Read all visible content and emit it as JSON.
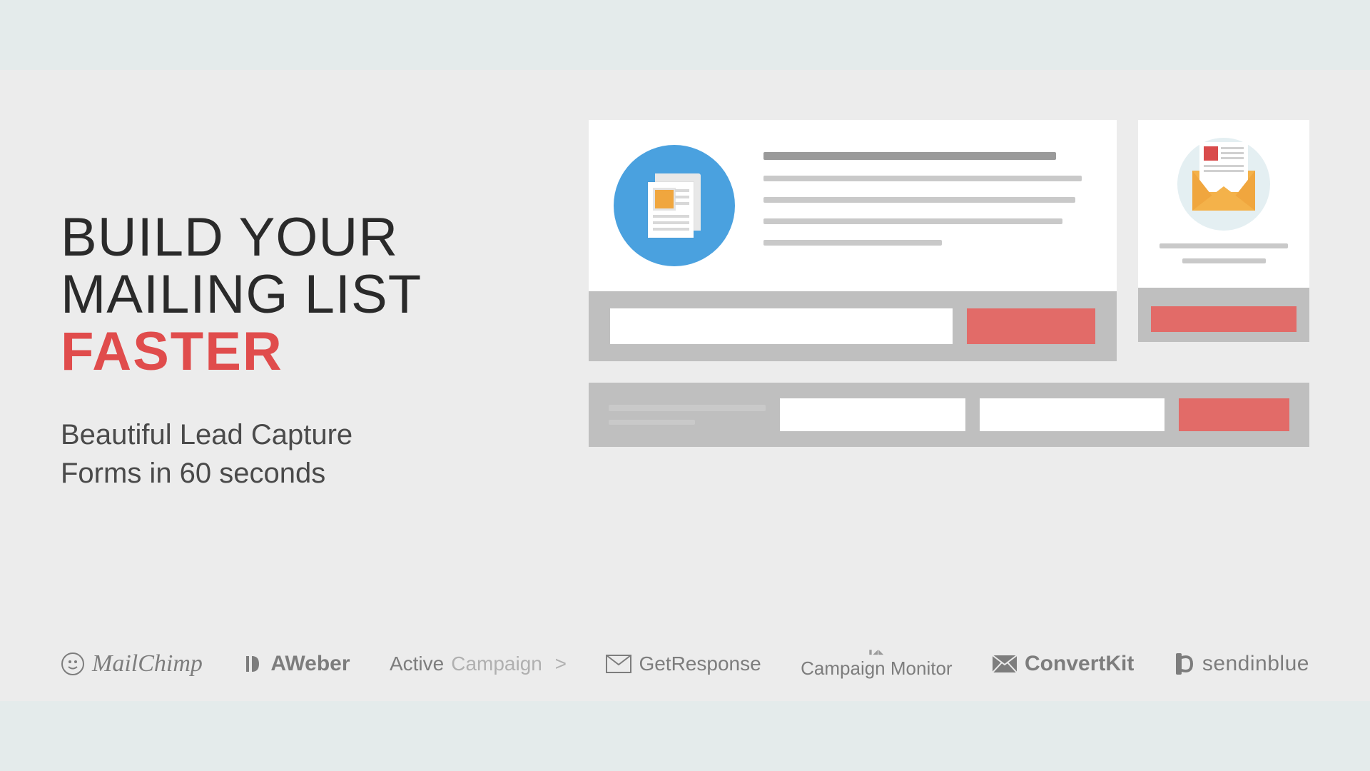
{
  "hero": {
    "line1": "BUILD YOUR",
    "line2": "MAILING LIST",
    "accent": "FASTER",
    "sub1": "Beautiful Lead Capture",
    "sub2": "Forms in 60 seconds"
  },
  "logos": {
    "mailchimp": "MailChimp",
    "aweber": "AWeber",
    "activecampaign_a": "Active",
    "activecampaign_b": "Campaign",
    "getresponse": "GetResponse",
    "campaignmonitor": "Campaign Monitor",
    "convertkit": "ConvertKit",
    "sendinblue": "sendinblue"
  },
  "colors": {
    "accent_red": "#e04c4c",
    "button_red": "#e26b68",
    "circle_blue": "#4aa1df",
    "envelope_orange": "#f4b24a"
  }
}
